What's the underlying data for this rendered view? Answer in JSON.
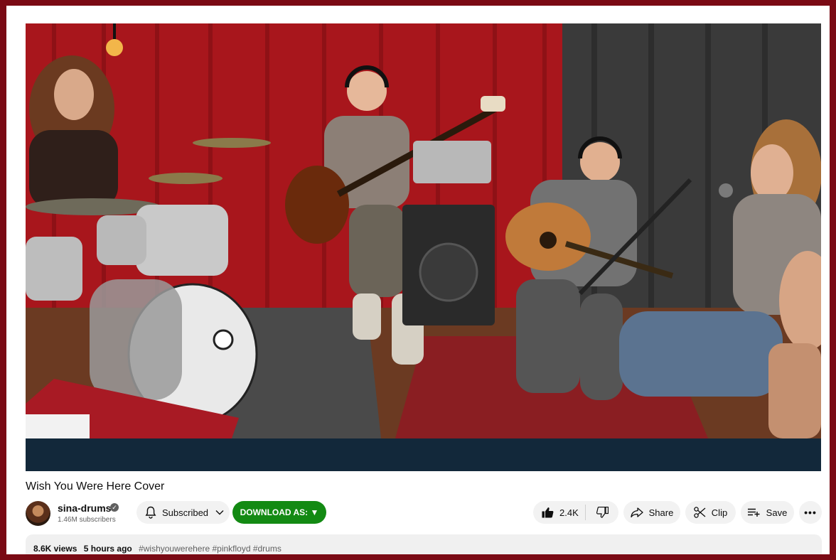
{
  "video": {
    "title": "Wish You Were Here Cover"
  },
  "channel": {
    "name": "sina-drums",
    "verified_mark": "✓",
    "subscribers": "1.46M subscribers"
  },
  "actions": {
    "subscribed_label": "Subscribed",
    "download_label": "DOWNLOAD AS: ▼",
    "likes": "2.4K",
    "share_label": "Share",
    "clip_label": "Clip",
    "save_label": "Save",
    "more_label": "•••"
  },
  "description": {
    "views": "8.6K views",
    "time": "5 hours ago",
    "tags": "#wishyouwerehere #pinkfloyd #drums"
  },
  "colors": {
    "frame": "#7a0a14",
    "download_button": "#138a13",
    "video_bar": "#12283a",
    "curtain_red": "#a8161c"
  },
  "icons": [
    "verified-icon",
    "bell-icon",
    "chevron-down-icon",
    "thumbs-up-icon",
    "thumbs-down-icon",
    "share-icon",
    "scissors-icon",
    "playlist-add-icon",
    "more-icon"
  ]
}
